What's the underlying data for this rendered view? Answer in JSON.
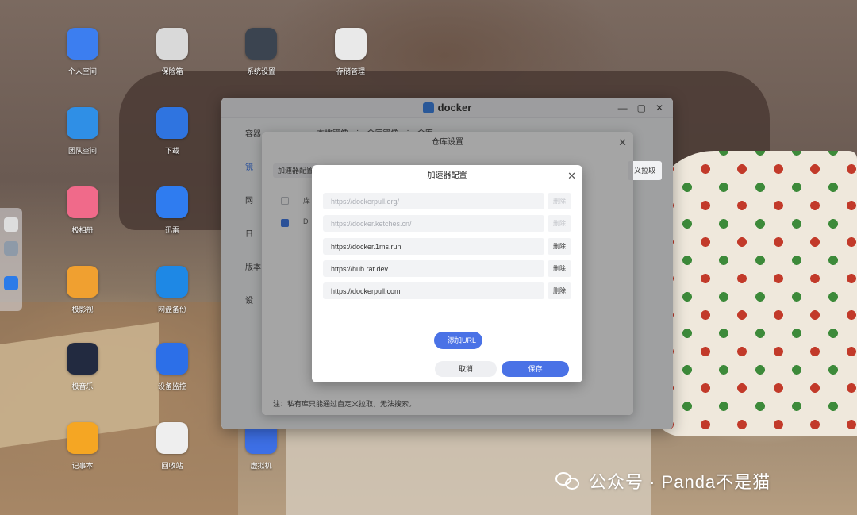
{
  "desktop_icons": [
    {
      "label": "个人空间",
      "icon": "folder-icon",
      "color": "#3c7ef0"
    },
    {
      "label": "保险箱",
      "icon": "safe-icon",
      "color": "#d9d9d9"
    },
    {
      "label": "系统设置",
      "icon": "settings-icon",
      "color": "#3b4450"
    },
    {
      "label": "存储管理",
      "icon": "storage-icon",
      "color": "#e9e9e9"
    },
    {
      "label": "团队空间",
      "icon": "team-folder-icon",
      "color": "#2f8fe6"
    },
    {
      "label": "下载",
      "icon": "download-globe-icon",
      "color": "#2f74e0"
    },
    {
      "label": "极相册",
      "icon": "photos-icon",
      "color": "#f06a8a"
    },
    {
      "label": "迅雷",
      "icon": "thunder-icon",
      "color": "#2f7cf0"
    },
    {
      "label": "极影视",
      "icon": "video-icon",
      "color": "#f0a030"
    },
    {
      "label": "网盘备份",
      "icon": "cloud-backup-icon",
      "color": "#1e88e5"
    },
    {
      "label": "极音乐",
      "icon": "music-icon",
      "color": "#222a40"
    },
    {
      "label": "设备监控",
      "icon": "monitor-chart-icon",
      "color": "#2c6fe8"
    },
    {
      "label": "记事本",
      "icon": "notepad-icon",
      "color": "#f5a623"
    },
    {
      "label": "回收站",
      "icon": "trash-icon",
      "color": "#eeeeee"
    },
    {
      "label": "虚拟机",
      "icon": "vm-icon",
      "color": "#3d6fe5"
    }
  ],
  "docker_window": {
    "title": "docker",
    "sidebar": [
      "容器",
      "镜",
      "网",
      "日",
      "版本",
      "设"
    ],
    "tabs": [
      "本地镜像",
      "·",
      "仓库镜像",
      "·",
      "仓库"
    ]
  },
  "repo_dialog": {
    "title": "仓库设置",
    "accelerator_button": "加速器配置",
    "custom_pull_button": "义拉取",
    "footer_note": "注：私有库只能通过自定义拉取，无法搜索。",
    "column_partial": "库",
    "row_partial": "D"
  },
  "accelerator_dialog": {
    "title": "加速器配置",
    "urls": [
      {
        "value": "https://dockerpull.org/",
        "disabled": true
      },
      {
        "value": "https://docker.ketches.cn/",
        "disabled": true
      },
      {
        "value": "https://docker.1ms.run",
        "disabled": false
      },
      {
        "value": "https://hub.rat.dev",
        "disabled": false
      },
      {
        "value": "https://dockerpull.com",
        "disabled": false
      }
    ],
    "delete_label": "删除",
    "add_url_label": "添加URL",
    "cancel_label": "取消",
    "save_label": "保存"
  },
  "watermark": {
    "text": "公众号 · Panda不是猫"
  }
}
